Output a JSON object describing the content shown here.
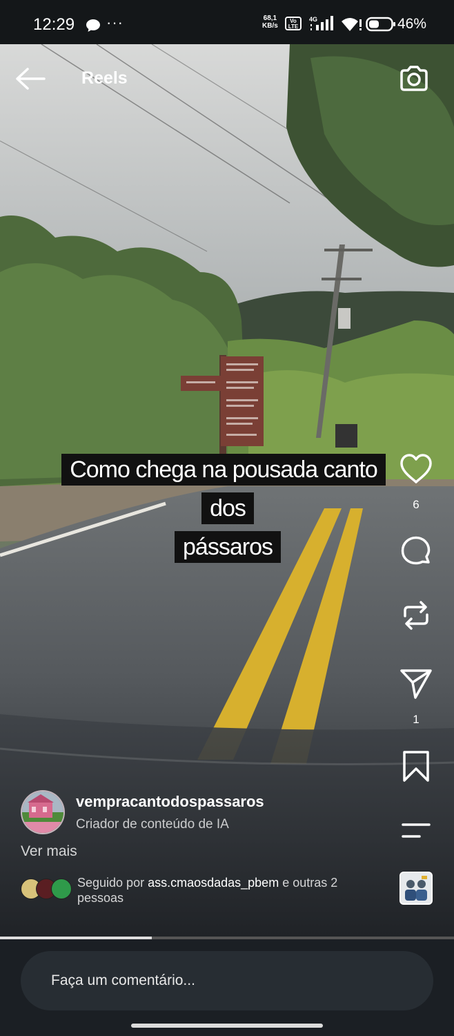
{
  "status_bar": {
    "time": "12:29",
    "dots": "···",
    "speed_value": "68,1",
    "speed_unit": "KB/s",
    "volte_top": "Vo",
    "volte_bottom": "LTE",
    "network": "4G",
    "battery_percent": "46%",
    "battery_level": 0.46,
    "icons": [
      "chat-bubble-icon",
      "volte-icon",
      "signal-icon",
      "wifi-icon",
      "battery-icon"
    ]
  },
  "header": {
    "title": "Reels",
    "back_icon": "arrow-left-icon",
    "camera_icon": "camera-icon"
  },
  "caption": {
    "line1": "Como chega na pousada canto dos",
    "line2": "pássaros"
  },
  "actions": {
    "like_icon": "heart-icon",
    "like_count": "6",
    "comment_icon": "comment-icon",
    "repost_icon": "repost-icon",
    "share_icon": "paper-plane-icon",
    "share_count": "1",
    "save_icon": "bookmark-icon",
    "more_icon": "menu-lines-icon",
    "audio_icon": "audio-thumbnail"
  },
  "author": {
    "username": "vempracantodospassaros",
    "subtitle": "Criador de conteúdo de IA",
    "see_more": "Ver mais"
  },
  "followed_by": {
    "prefix": "Seguido por ",
    "account": "ass.cmaosdadas_pbem",
    "suffix": " e outras 2 pessoas"
  },
  "playback": {
    "progress": 0.335
  },
  "comment": {
    "placeholder": "Faça um comentário..."
  },
  "colors": {
    "background": "#1b1f24",
    "comment_bar": "#272d33",
    "road_line": "#d7b02e"
  }
}
